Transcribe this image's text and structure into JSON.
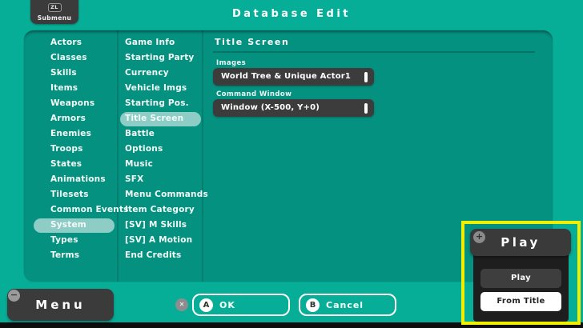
{
  "colors": {
    "background": "#07ae97",
    "panel": "#049180",
    "selection_pill": "#9ed5ca",
    "dark_button": "#3b3b3b",
    "popup_panel": "#1e1e1e",
    "highlight_border": "#f1ee00"
  },
  "top_bar": {
    "submenu_button": {
      "badge": "ZL",
      "label": "Submenu"
    },
    "title": "Database Edit"
  },
  "left_list": {
    "items": [
      "Actors",
      "Classes",
      "Skills",
      "Items",
      "Weapons",
      "Armors",
      "Enemies",
      "Troops",
      "States",
      "Animations",
      "Tilesets",
      "Common Events",
      "System",
      "Types",
      "Terms"
    ],
    "selected": "System"
  },
  "middle_list": {
    "items": [
      "Game Info",
      "Starting Party",
      "Currency",
      "Vehicle Imgs",
      "Starting Pos.",
      "Title Screen",
      "Battle",
      "Options",
      "Music",
      "SFX",
      "Menu Commands",
      "Item Category",
      "[SV] M Skills",
      "[SV] A Motion",
      "End Credits"
    ],
    "selected": "Title Screen"
  },
  "detail_panel": {
    "title": "Title Screen",
    "fields": [
      {
        "label": "Images",
        "value": "World Tree & Unique Actor1"
      },
      {
        "label": "Command Window",
        "value": "Window (X-500, Y+0)"
      }
    ]
  },
  "bottom_bar": {
    "menu_button": {
      "icon": "−",
      "label": "Menu"
    },
    "close_icon": "✕",
    "ok_button": {
      "key": "A",
      "label": "OK"
    },
    "cancel_button": {
      "key": "B",
      "label": "Cancel"
    }
  },
  "popup": {
    "header": {
      "icon": "+",
      "label": "Play"
    },
    "items": [
      {
        "label": "Play"
      },
      {
        "label": "From Title"
      }
    ],
    "selected": "From Title"
  }
}
